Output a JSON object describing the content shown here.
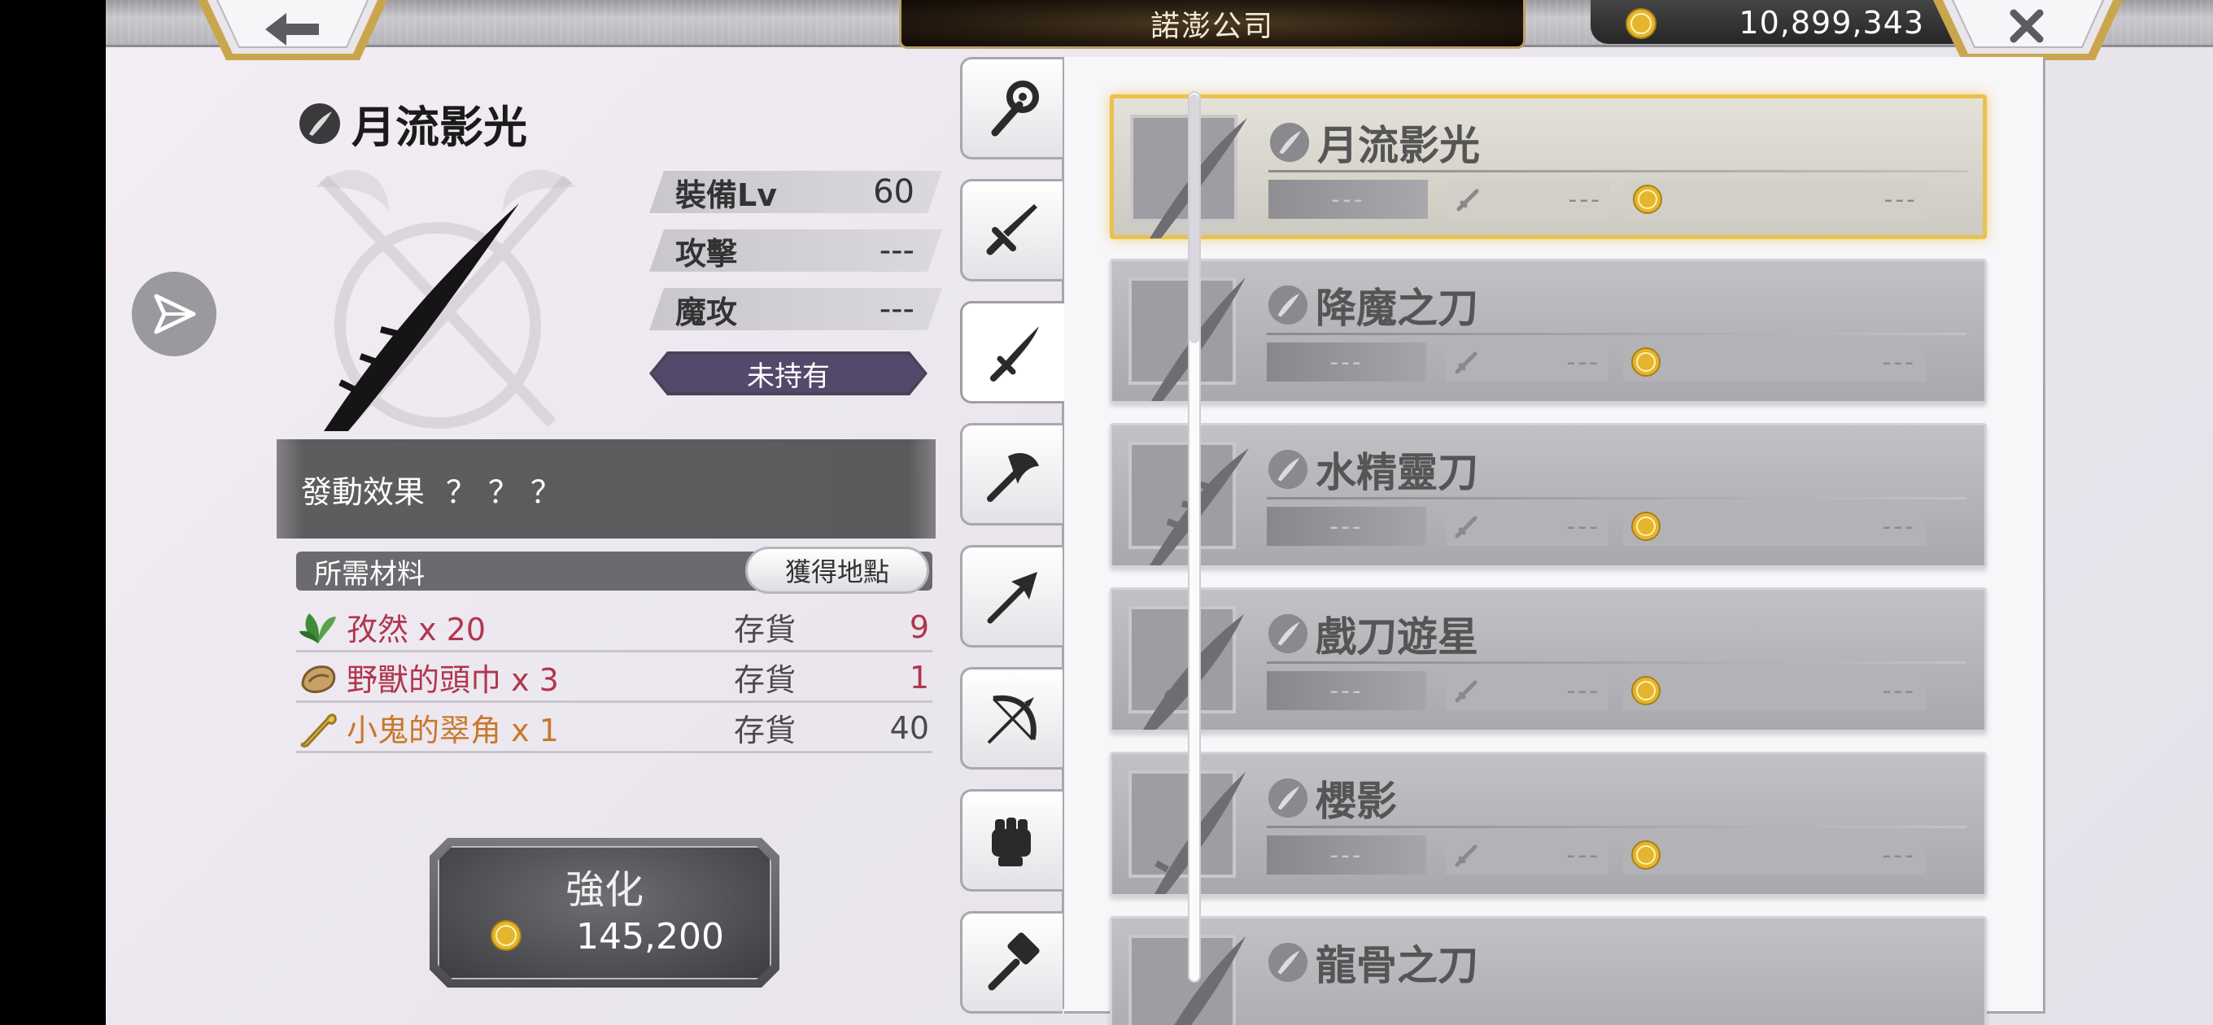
{
  "header": {
    "title": "諾澎公司",
    "gold": "10,899,343"
  },
  "equipment": {
    "name": "月流影光",
    "stats": [
      {
        "label": "裝備Lv",
        "value": "60"
      },
      {
        "label": "攻擊",
        "value": "---"
      },
      {
        "label": "魔攻",
        "value": "---"
      }
    ],
    "status": "未持有",
    "effect_label": "發動效果",
    "effect_value": "？？？"
  },
  "materials": {
    "header": "所需材料",
    "source_button": "獲得地點",
    "items": [
      {
        "name": "孜然 x 20",
        "stock_label": "存貨",
        "stock": "9",
        "color": "#b0364e",
        "icon": "herb-icon"
      },
      {
        "name": "野獸的頭巾 x 3",
        "stock_label": "存貨",
        "stock": "1",
        "color": "#b0364e",
        "icon": "cloth-icon"
      },
      {
        "name": "小鬼的翠角 x 1",
        "stock_label": "存貨",
        "stock": "40",
        "color": "#c9782b",
        "icon": "bone-icon"
      }
    ]
  },
  "enhance": {
    "label": "強化",
    "cost": "145,200"
  },
  "tabs": [
    {
      "icon": "staff-icon"
    },
    {
      "icon": "sword-icon"
    },
    {
      "icon": "katana-icon"
    },
    {
      "icon": "axe-icon"
    },
    {
      "icon": "spear-icon"
    },
    {
      "icon": "bow-icon"
    },
    {
      "icon": "fist-icon"
    },
    {
      "icon": "hammer-icon"
    }
  ],
  "weapon_list": [
    {
      "name": "月流影光",
      "lv": "---",
      "atk": "---",
      "cost": "---"
    },
    {
      "name": "降魔之刀",
      "lv": "---",
      "atk": "---",
      "cost": "---"
    },
    {
      "name": "水精靈刀",
      "lv": "---",
      "atk": "---",
      "cost": "---"
    },
    {
      "name": "戲刀遊星",
      "lv": "---",
      "atk": "---",
      "cost": "---"
    },
    {
      "name": "櫻影",
      "lv": "---",
      "atk": "---",
      "cost": "---"
    },
    {
      "name": "龍骨之刀",
      "lv": "---",
      "atk": "---",
      "cost": "---"
    }
  ],
  "colors": {
    "accent_gold": "#e9c24c",
    "owned_badge": "#4a4258",
    "material_red": "#b0364e",
    "material_orange": "#c9782b"
  }
}
